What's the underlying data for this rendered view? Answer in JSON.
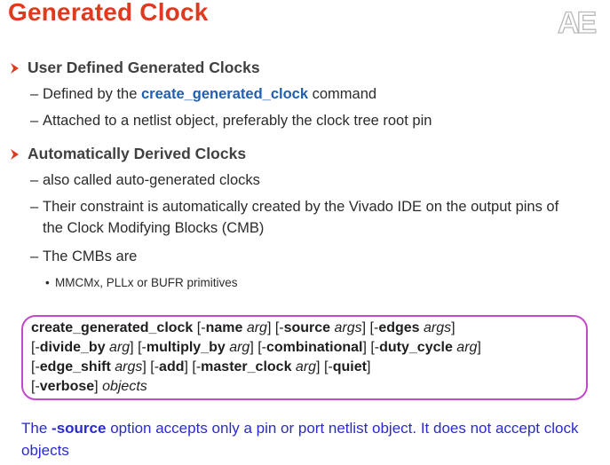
{
  "slide": {
    "title": "Generated Clock",
    "logo_text": "AE"
  },
  "sections": [
    {
      "heading": "User Defined Generated Clocks",
      "items": [
        {
          "dash": "–",
          "before": "Defined by the",
          "keyword": "create_generated_clock",
          "after": "command"
        },
        {
          "dash": "–",
          "text": "Attached to a netlist object, preferably the clock tree root pin"
        }
      ]
    },
    {
      "heading": "Automatically Derived Clocks",
      "items": [
        {
          "dash": "–",
          "text": "also called auto-generated clocks"
        },
        {
          "dash": "–",
          "text": "Their constraint is automatically created by the Vivado IDE on the output pins of",
          "text_cont": "the Clock Modifying Blocks (CMB)"
        },
        {
          "dash": "–",
          "text": "The CMBs are"
        }
      ],
      "subitems": [
        {
          "bullet": "•",
          "text": "MMCMx, PLLx or BUFR primitives"
        }
      ]
    }
  ],
  "command": {
    "line1": {
      "cmd": "create_generated_clock",
      "o1": "[-",
      "n1": "name",
      "a1": "arg",
      "c1": "] [-",
      "n2": "source",
      "a2": "args",
      "c2": "] [-",
      "n3": "edges",
      "a3": "args",
      "c3": "]"
    },
    "line2": {
      "o1": "[-",
      "n1": "divide_by",
      "a1": "arg",
      "c1": "] [-",
      "n2": "multiply_by",
      "a2": "arg",
      "c2": "] [-",
      "n3": "combinational",
      "c3": "] [-",
      "n4": "duty_cycle",
      "a4": "arg",
      "c4": "]"
    },
    "line3": {
      "o1": "[-",
      "n1": "edge_shift",
      "a1": "args",
      "c1": "] [-",
      "n2": "add",
      "c2": "] [-",
      "n3": "master_clock",
      "a3": "arg",
      "c3": "] [-",
      "n4": "quiet",
      "c4": "]"
    },
    "line4": {
      "o1": "[-",
      "n1": "verbose",
      "c1": "]",
      "a1": "objects"
    }
  },
  "note": {
    "before": "The",
    "option": "-source",
    "after": "option accepts only a pin or port netlist object. It does not accept clock objects"
  },
  "colors": {
    "title": "#e03a1e",
    "chevron": "#e03a1e",
    "keyword": "#1f5fb4",
    "box_border": "#c348c9",
    "note": "#2a2ad0"
  }
}
